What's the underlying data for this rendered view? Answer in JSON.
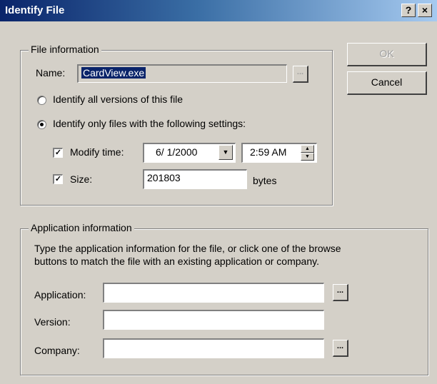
{
  "window": {
    "title": "Identify File",
    "help_glyph": "?",
    "close_glyph": "×"
  },
  "buttons": {
    "ok": "OK",
    "cancel": "Cancel"
  },
  "file_info": {
    "group_label": "File information",
    "name_label": "Name:",
    "name_value": "CardView.exe",
    "browse_label": "...",
    "radio_all": "Identify all versions of this file",
    "radio_only": "Identify only files with the following settings:",
    "selected_radio": "only",
    "modify_time_label": "Modify time:",
    "modify_time_checked": true,
    "date_value": "6/ 1/2000",
    "time_value": "2:59 AM",
    "size_label": "Size:",
    "size_checked": true,
    "size_value": "201803",
    "bytes_label": "bytes",
    "check_glyph": "✓",
    "dropdown_glyph": "▼",
    "spin_up_glyph": "▲",
    "spin_down_glyph": "▼"
  },
  "app_info": {
    "group_label": "Application information",
    "description_line1": "Type the application information for the file, or click one of the browse",
    "description_line2": "buttons to match the file with an existing application or company.",
    "application_label": "Application:",
    "application_value": "",
    "version_label": "Version:",
    "version_value": "",
    "company_label": "Company:",
    "company_value": "",
    "browse_label": "..."
  }
}
